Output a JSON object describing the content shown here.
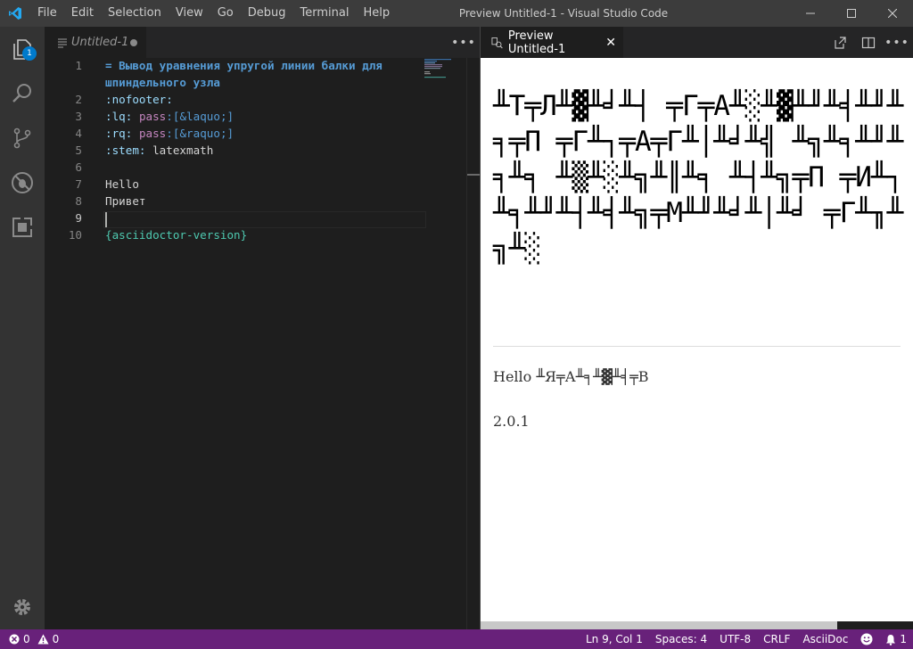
{
  "titlebar": {
    "menu": [
      "File",
      "Edit",
      "Selection",
      "View",
      "Go",
      "Debug",
      "Terminal",
      "Help"
    ],
    "window_title": "Preview Untitled-1 - Visual Studio Code"
  },
  "activitybar": {
    "items": [
      {
        "name": "explorer-icon",
        "badge": "1"
      },
      {
        "name": "search-icon"
      },
      {
        "name": "source-control-icon"
      },
      {
        "name": "debug-icon"
      },
      {
        "name": "extensions-icon"
      }
    ],
    "bottom": "gear-icon"
  },
  "editor": {
    "tab_label": "Untitled-1",
    "more_label": "•••",
    "lines": [
      {
        "num": "1",
        "segments": [
          {
            "cls": "c-heading",
            "text": "= Вывод уравнения упругой линии балки для"
          }
        ]
      },
      {
        "num": "",
        "segments": [
          {
            "cls": "c-heading",
            "text": "шпиндельного узла"
          }
        ]
      },
      {
        "num": "2",
        "segments": [
          {
            "cls": "c-attr",
            "text": ":nofooter:"
          }
        ]
      },
      {
        "num": "3",
        "segments": [
          {
            "cls": "c-attr",
            "text": ":lq:"
          },
          {
            "cls": "",
            "text": " "
          },
          {
            "cls": "c-macro",
            "text": "pass"
          },
          {
            "cls": "c-bracket",
            "text": ":[&laquo;]"
          }
        ]
      },
      {
        "num": "4",
        "segments": [
          {
            "cls": "c-attr",
            "text": ":rq:"
          },
          {
            "cls": "",
            "text": " "
          },
          {
            "cls": "c-macro",
            "text": "pass"
          },
          {
            "cls": "c-bracket",
            "text": ":[&raquo;]"
          }
        ]
      },
      {
        "num": "5",
        "segments": [
          {
            "cls": "c-attr",
            "text": ":stem:"
          },
          {
            "cls": "",
            "text": " latexmath"
          }
        ]
      },
      {
        "num": "6",
        "segments": []
      },
      {
        "num": "7",
        "segments": [
          {
            "cls": "",
            "text": "Hello"
          }
        ]
      },
      {
        "num": "8",
        "segments": [
          {
            "cls": "",
            "text": "Привет"
          }
        ]
      },
      {
        "num": "9",
        "segments": []
      },
      {
        "num": "10",
        "segments": [
          {
            "cls": "c-var",
            "text": "{asciidoctor-version}"
          }
        ]
      }
    ],
    "active_line": "9"
  },
  "preview": {
    "tab_label": "Preview Untitled-1",
    "close": "✕",
    "title_text": "╨Т╤Л╨▓╨╛╨┤ ╤Г╤А╨░╨▓╨╜╨╡╨╜╨╕╤П ╤Г╨┐╤А╤Г╨│╨╛╨╣ ╨╗╨╕╨╜╨╕╨╕ ╨▒╨░╨╗╨║╨╕ ╨┤╨╗╤П ╤И╨┐╨╕╨╜╨┤╨╡╨╗╤М╨╜╨╛╨│╨╛ ╤Г╨╖╨╗╨░",
    "para1": "Hello ╨Я╤А╨╕╨▓╨╡╤В",
    "para2": "2.0.1"
  },
  "statusbar": {
    "errors": "0",
    "warnings": "0",
    "position": "Ln 9, Col 1",
    "spaces": "Spaces: 4",
    "encoding": "UTF-8",
    "eol": "CRLF",
    "language": "AsciiDoc",
    "notifications": "1"
  }
}
